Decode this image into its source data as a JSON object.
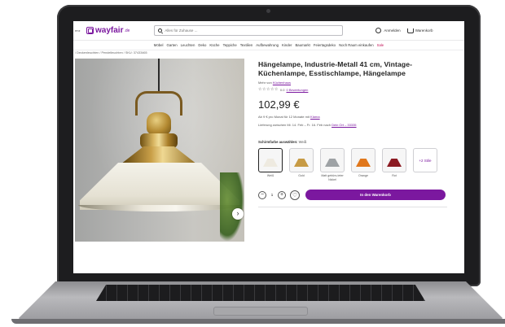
{
  "header": {
    "left_text": "enz",
    "logo_text": "wayfair",
    "logo_tld": ".de",
    "search_placeholder": "Alles für Zuhause ...",
    "account_label": "Anmelden",
    "cart_label": "Warenkorb"
  },
  "nav": {
    "items": [
      "Möbel",
      "Garten",
      "Leuchten",
      "Deko",
      "Küche",
      "Teppiche",
      "Textilien",
      "Aufbewahrung",
      "Kinder",
      "Baumarkt",
      "Feiertagsdeko",
      "Noch Raum einkaufen"
    ],
    "sale_label": "Sale"
  },
  "breadcrumb": "/ Deckenleuchten / Pendelleuchten / SKU: 37433465",
  "product": {
    "title": "Hängelampe, Industrie-Metall 41 cm, Vintage-Küchenlampe, Esstischlampe, Hängelampe",
    "brand_prefix": "Mehr von",
    "brand_name": "Küchenhaus",
    "stars": "☆☆☆☆☆",
    "rating_value": "0.0",
    "reviews_link": "0 Bewertungen",
    "price": "102,99 €",
    "finance_text": "Ab 9 € pro Monat für 12 Monate mit",
    "finance_link": "Klarna",
    "delivery_text": "Lieferung zwischen Mi. 14. Feb – Fr. 16. Feb nach",
    "delivery_link": "Dein Ort – 33335",
    "color_label": "Schirmfarbe auswählen:",
    "color_value": "Weiß",
    "swatches": [
      {
        "label": "Weiß",
        "color": "#eeeae0"
      },
      {
        "label": "Gold",
        "color": "#c79b45"
      },
      {
        "label": "Matt gebürs-teter Nickel",
        "color": "#9ea2a5"
      },
      {
        "label": "Orange",
        "color": "#e0771c"
      },
      {
        "label": "Rot",
        "color": "#8b1a22"
      }
    ],
    "more_label": "+2 Stile",
    "qty": "1",
    "add_to_cart": "In den Warenkorb"
  },
  "colors": {
    "brand_purple": "#7b189f",
    "sale_pink": "#c4155a"
  }
}
